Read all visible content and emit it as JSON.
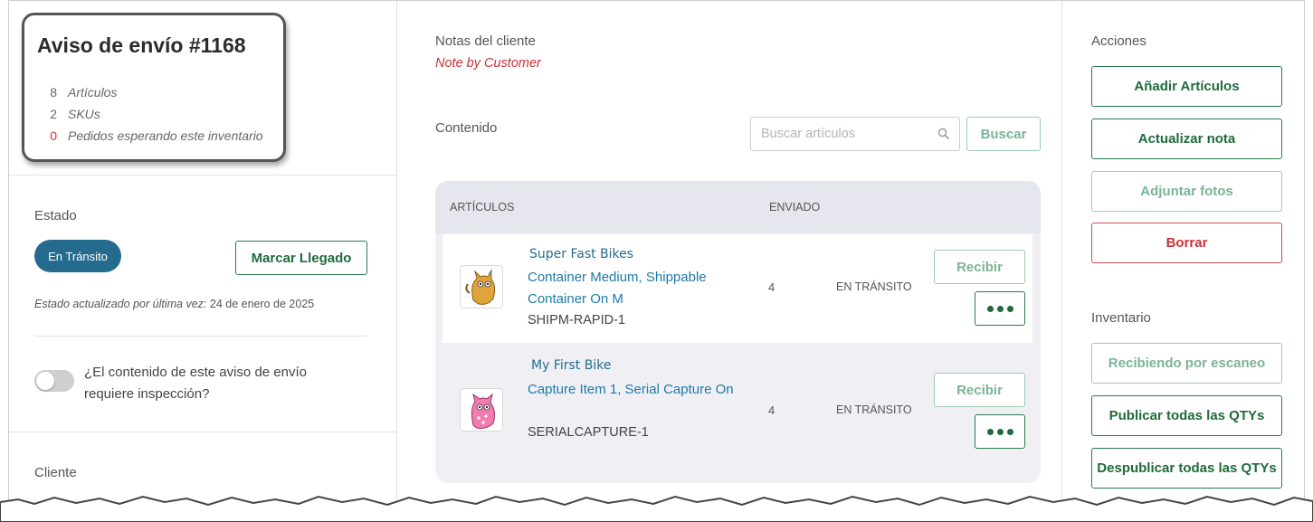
{
  "summary": {
    "title": "Aviso de envío #1168",
    "rows": [
      {
        "num": "8",
        "label": "Artículos"
      },
      {
        "num": "2",
        "label": "SKUs"
      },
      {
        "num": "0",
        "label": "Pedidos esperando este inventario"
      }
    ]
  },
  "state": {
    "label": "Estado",
    "pill": "En Tránsito",
    "mark_arrived": "Marcar Llegado",
    "updated_prefix": "Estado actualizado por última vez:",
    "updated_date": " 24 de enero de 2025",
    "inspection_question": "¿El contenido de este aviso de envío requiere inspección?",
    "inspection_enabled": false
  },
  "client": {
    "label": "Cliente"
  },
  "notes": {
    "label": "Notas del cliente",
    "value": "Note by Customer"
  },
  "contents": {
    "label": "Contenido",
    "search_placeholder": "Buscar artículos",
    "search_button": "Buscar",
    "columns": [
      "ARTÍCULOS",
      "ENVIADO"
    ],
    "items": [
      {
        "brand": "Super Fast Bikes",
        "name": "Container Medium, Shippable Container On M",
        "sku": "SHIPM-RAPID-1",
        "sent": "4",
        "status": "EN TRÁNSITO",
        "receive": "Recibir",
        "thumb_icon": "orange-cat-icon"
      },
      {
        "brand": "My First Bike",
        "name": "Capture Item 1, Serial Capture On",
        "sku": "SERIALCAPTURE-1",
        "sent": "4",
        "status": "EN TRÁNSITO",
        "receive": "Recibir",
        "thumb_icon": "pink-cat-icon"
      }
    ]
  },
  "actions": {
    "label": "Acciones",
    "add_items": "Añadir Artículos",
    "update_note": "Actualizar nota",
    "attach_photos": "Adjuntar fotos",
    "delete": "Borrar"
  },
  "inventory": {
    "label": "Inventario",
    "scan_receiving": "Recibiendo por escaneo",
    "publish_all": "Publicar todas las QTYs",
    "unpublish_all": "Despublicar todas las QTYs"
  },
  "colors": {
    "green": "#1f6a3c",
    "blue_pill": "#256b8e",
    "red": "#c8323a",
    "link": "#1e7aa8"
  }
}
